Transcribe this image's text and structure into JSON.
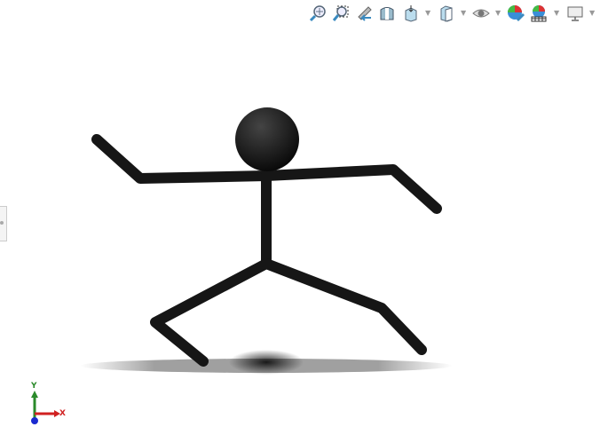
{
  "toolbar": {
    "items": [
      "zoom-to-fit",
      "zoom-to-area",
      "previous-view",
      "section-view",
      "view-orientation",
      "display-style",
      "hide-show-items",
      "edit-appearance",
      "apply-scene",
      "view-settings"
    ]
  },
  "triad": {
    "x_label": "X",
    "y_label": "Y"
  },
  "colors": {
    "background": "#ffffff",
    "model": "#151515",
    "x_axis": "#d02020",
    "y_axis": "#2a8a2a",
    "z_axis": "#1a2ad0"
  }
}
